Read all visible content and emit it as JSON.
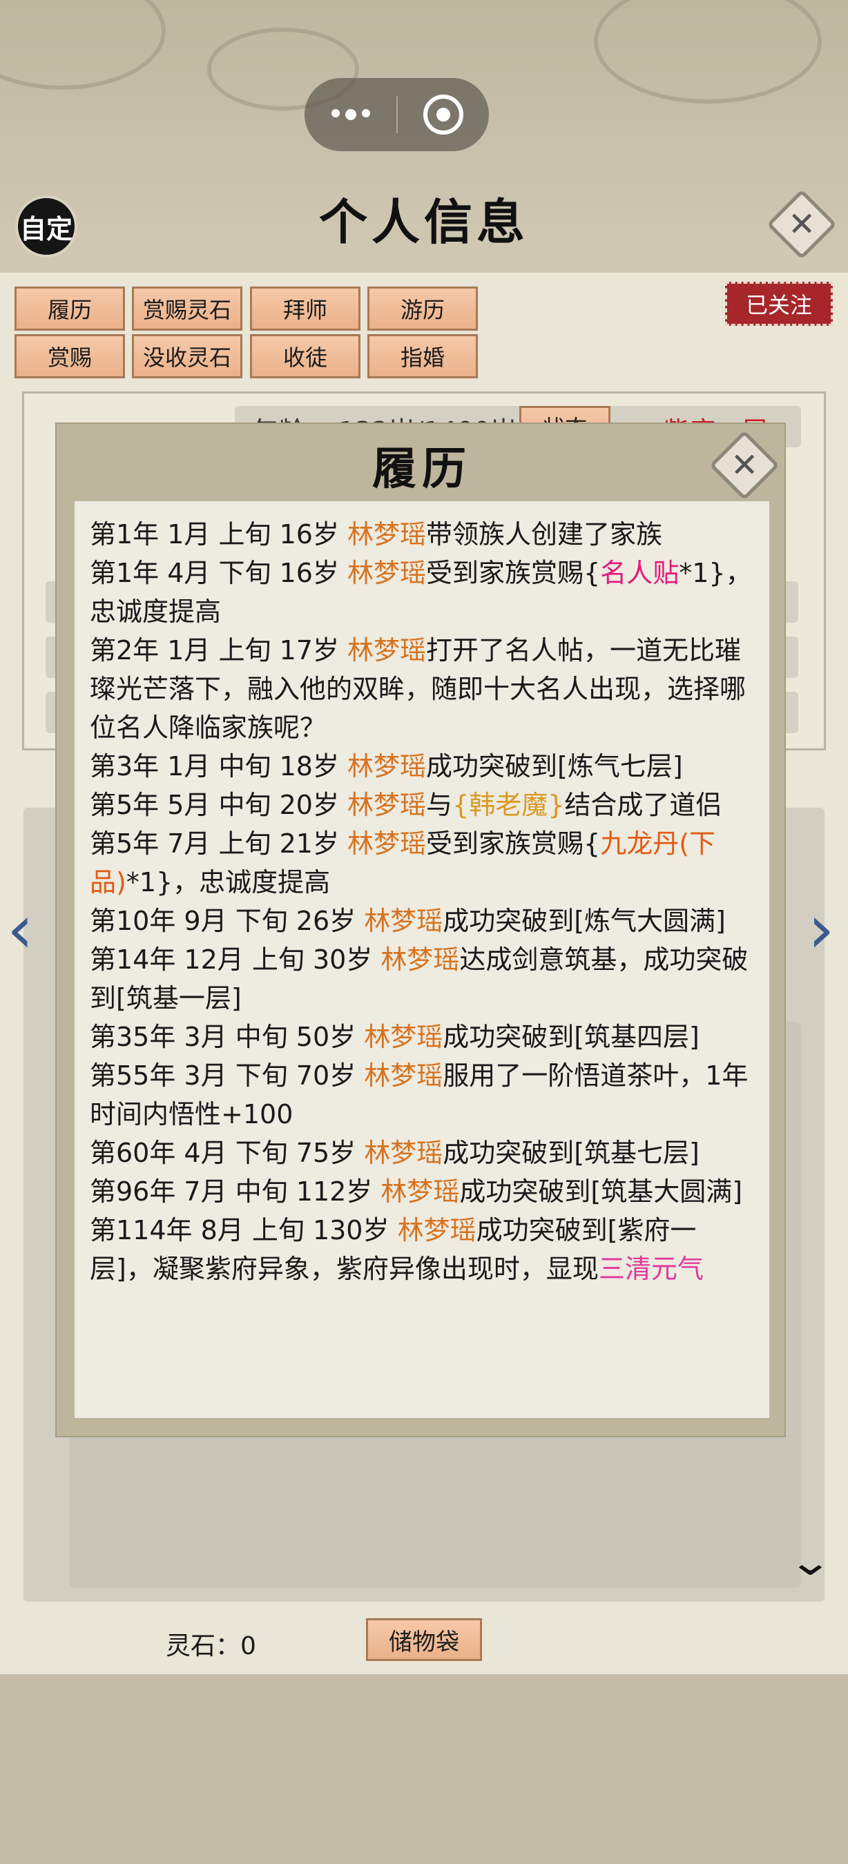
{
  "header": {
    "auto_label": "自定",
    "title": "个人信息"
  },
  "tabs": [
    {
      "label": "履历"
    },
    {
      "label": "赏赐灵石"
    },
    {
      "label": "拜师"
    },
    {
      "label": "游历"
    },
    {
      "label": "赏赐"
    },
    {
      "label": "没收灵石"
    },
    {
      "label": "收徒"
    },
    {
      "label": "指婚"
    }
  ],
  "follow_label": "已关注",
  "info": {
    "age_label": "年龄：",
    "age_value": "132岁/1400岁",
    "state_label": "状态",
    "realm_hint": "紫府一层"
  },
  "modal": {
    "title": "履历",
    "entries": [
      [
        {
          "t": "第1年 1月 上旬  16岁  "
        },
        {
          "t": "林梦瑶",
          "c": "nm"
        },
        {
          "t": "带领族人创建了家族"
        }
      ],
      [
        {
          "t": "第1年 4月 下旬   16岁   "
        },
        {
          "t": "林梦瑶",
          "c": "nm"
        },
        {
          "t": "受到家族赏赐{"
        },
        {
          "t": "名人贴",
          "c": "item-pink"
        },
        {
          "t": "*1}，忠诚度提高"
        }
      ],
      [
        {
          "t": "第2年 1月 上旬 17岁  "
        },
        {
          "t": "林梦瑶",
          "c": "nm"
        },
        {
          "t": "打开了名人帖，一道无比璀璨光芒落下，融入他的双眸，随即十大名人出现，选择哪位名人降临家族呢？"
        }
      ],
      [
        {
          "t": "第3年 1月 中旬  18岁  "
        },
        {
          "t": "林梦瑶",
          "c": "nm"
        },
        {
          "t": "成功突破到[炼气七层]"
        }
      ],
      [
        {
          "t": "第5年 5月 中旬  20岁  "
        },
        {
          "t": "林梦瑶",
          "c": "nm"
        },
        {
          "t": "与"
        },
        {
          "t": "{韩老魔}",
          "c": "item-gold"
        },
        {
          "t": "结合成了道侣"
        }
      ],
      [
        {
          "t": "第5年 7月 上旬  21岁  "
        },
        {
          "t": "林梦瑶",
          "c": "nm"
        },
        {
          "t": "受到家族赏赐{"
        },
        {
          "t": "九龙丹(下品)",
          "c": "item-orange"
        },
        {
          "t": "*1}，忠诚度提高"
        }
      ],
      [
        {
          "t": "第10年 9月 下旬  26岁  "
        },
        {
          "t": "林梦瑶",
          "c": "nm"
        },
        {
          "t": "成功突破到[炼气大圆满]"
        }
      ],
      [
        {
          "t": "第14年 12月 上旬  30岁  "
        },
        {
          "t": "林梦瑶",
          "c": "nm"
        },
        {
          "t": "达成剑意筑基，成功突破到[筑基一层]"
        }
      ],
      [
        {
          "t": "第35年 3月 中旬  50岁   "
        },
        {
          "t": "林梦瑶",
          "c": "nm"
        },
        {
          "t": "成功突破到[筑基四层]"
        }
      ],
      [
        {
          "t": "第55年 3月 下旬  70岁   "
        },
        {
          "t": "林梦瑶",
          "c": "nm"
        },
        {
          "t": "服用了一阶悟道茶叶，1年时间内悟性+100"
        }
      ],
      [
        {
          "t": "第60年 4月 下旬  75岁   "
        },
        {
          "t": "林梦瑶",
          "c": "nm"
        },
        {
          "t": "成功突破到[筑基七层]"
        }
      ],
      [
        {
          "t": "第96年 7月 中旬  112岁  "
        },
        {
          "t": "林梦瑶",
          "c": "nm"
        },
        {
          "t": "成功突破到[筑基大圆满]"
        }
      ],
      [
        {
          "t": "第114年 8月 上旬  130岁  "
        },
        {
          "t": "林梦瑶",
          "c": "nm"
        },
        {
          "t": "成功突破到[紫府一层]，凝聚紫府异象，紫府异像出现时，显现"
        },
        {
          "t": "三清元气",
          "c": "item-magenta"
        }
      ]
    ]
  },
  "footer": {
    "stone_label": "灵石：0",
    "bag_label": "储物袋"
  },
  "colors": {
    "name": "#d6731f",
    "tab_fill": "#eab18a",
    "follow_badge": "#a6262a",
    "nav_arrow": "#3a5a8c"
  },
  "icons": {
    "capsule_more": "more-dots-icon",
    "capsule_record": "record-icon",
    "close": "close-icon",
    "prev": "arrow-left-icon",
    "next": "arrow-right-icon",
    "expand": "chevron-down-icon"
  }
}
